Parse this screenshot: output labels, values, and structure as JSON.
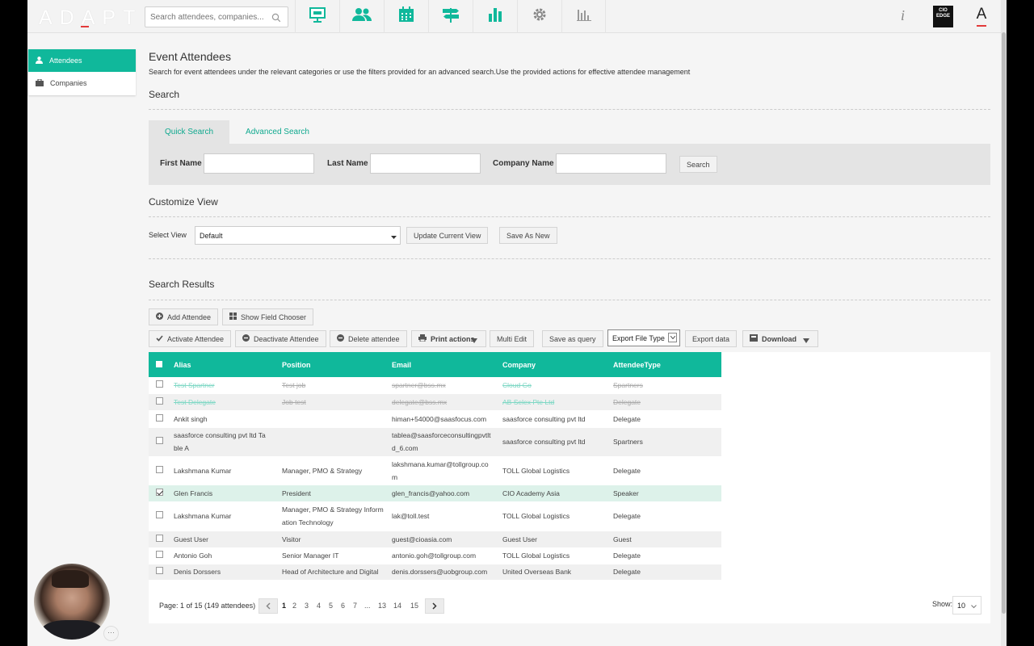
{
  "app": {
    "logo": "ADAPT"
  },
  "search": {
    "placeholder": "Search attendees, companies..."
  },
  "nav": {
    "icons": [
      "presentation-icon",
      "users-icon",
      "calendar-icon",
      "signpost-icon",
      "bar-chart-icon",
      "gear-icon",
      "reports-icon"
    ]
  },
  "header_right": {
    "info": "i",
    "cio_label_1": "CIO",
    "cio_label_2": "EDGE",
    "account_letter": "A"
  },
  "sidebar": {
    "items": [
      {
        "label": "Attendees",
        "active": true
      },
      {
        "label": "Companies",
        "active": false
      }
    ]
  },
  "page": {
    "title": "Event Attendees",
    "description": "Search for event attendees under the relevant categories or use the filters provided for an advanced search.Use the provided actions for effective attendee management",
    "search_heading": "Search",
    "tabs": [
      {
        "label": "Quick Search",
        "active": true
      },
      {
        "label": "Advanced Search",
        "active": false
      }
    ],
    "quick": {
      "first_name": "First Name",
      "last_name": "Last Name",
      "company_name": "Company Name",
      "search_button": "Search"
    },
    "customize_heading": "Customize View",
    "select_view_label": "Select View",
    "select_view_value": "Default",
    "update_view": "Update Current View",
    "save_as_new": "Save As New",
    "results_heading": "Search Results"
  },
  "actions": {
    "add": "Add Attendee",
    "field_chooser": "Show Field Chooser",
    "activate": "Activate Attendee",
    "deactivate": "Deactivate Attendee",
    "delete": "Delete attendee",
    "print": "Print actions",
    "multi_edit": "Multi Edit",
    "save_query": "Save as query",
    "export_type": "Export File Type",
    "export_data": "Export data",
    "download": "Download"
  },
  "table": {
    "columns": [
      "Alias",
      "Position",
      "Email",
      "Company",
      "AttendeeType"
    ],
    "rows": [
      {
        "alias": [
          "Test Spartner"
        ],
        "position": [
          "Test job"
        ],
        "email": [
          "spartner@bss.mx"
        ],
        "company": "Cloud Go",
        "type": "Spartners",
        "state": "strike",
        "checked": false
      },
      {
        "alias": [
          "Test Delegate"
        ],
        "position": [
          "Job test"
        ],
        "email": [
          "delegate@bss.mx"
        ],
        "company": "AB Selex Pte Ltd",
        "type": "Delegate",
        "state": "strike",
        "checked": false
      },
      {
        "alias": [
          "Ankit singh"
        ],
        "position": [
          ""
        ],
        "email": [
          "himan+54000@saasfocus.com"
        ],
        "company": "saasforce consulting pvt ltd",
        "type": "Delegate",
        "state": "",
        "checked": false
      },
      {
        "alias": [
          "saasforce consulting pvt ltd Ta",
          "ble A"
        ],
        "position": [
          ""
        ],
        "email": [
          "tablea@saasforceconsultingpvtlt",
          "d_6.com"
        ],
        "company": "saasforce consulting pvt ltd",
        "type": "Spartners",
        "state": "alt",
        "checked": false
      },
      {
        "alias": [
          "Lakshmana Kumar"
        ],
        "position": [
          "Manager, PMO & Strategy"
        ],
        "email": [
          "lakshmana.kumar@tollgroup.co",
          "m"
        ],
        "company": "TOLL Global Logistics",
        "type": "Delegate",
        "state": "",
        "checked": false
      },
      {
        "alias": [
          "Glen Francis"
        ],
        "position": [
          "President"
        ],
        "email": [
          "glen_francis@yahoo.com"
        ],
        "company": "CIO Academy Asia",
        "type": "Speaker",
        "state": "sel",
        "checked": true
      },
      {
        "alias": [
          "Lakshmana Kumar"
        ],
        "position": [
          "Manager, PMO & Strategy Inform",
          "ation Technology"
        ],
        "email": [
          "lak@toll.test"
        ],
        "company": "TOLL Global Logistics",
        "type": "Delegate",
        "state": "",
        "checked": false
      },
      {
        "alias": [
          "Guest User"
        ],
        "position": [
          "Visitor"
        ],
        "email": [
          "guest@cioasia.com"
        ],
        "company": "Guest User",
        "type": "Guest",
        "state": "alt",
        "checked": false
      },
      {
        "alias": [
          "Antonio Goh"
        ],
        "position": [
          "Senior Manager IT"
        ],
        "email": [
          "antonio.goh@tollgroup.com"
        ],
        "company": "TOLL Global Logistics",
        "type": "Delegate",
        "state": "",
        "checked": false
      },
      {
        "alias": [
          "Denis Dorssers"
        ],
        "position": [
          "Head of Architecture and Digital"
        ],
        "email": [
          "denis.dorssers@uobgroup.com"
        ],
        "company": "United Overseas Bank",
        "type": "Delegate",
        "state": "alt",
        "checked": false
      }
    ]
  },
  "pager": {
    "info": "Page: 1 of 15 (149 attendees)",
    "pages": [
      "1",
      "2",
      "3",
      "4",
      "5",
      "6",
      "7",
      "...",
      "13",
      "14",
      "15"
    ],
    "current": "1",
    "show_label": "Show:",
    "show_value": "10"
  },
  "colors": {
    "accent": "#10b89b",
    "link": "#10a98f",
    "selected_row": "#ddf2ea"
  }
}
